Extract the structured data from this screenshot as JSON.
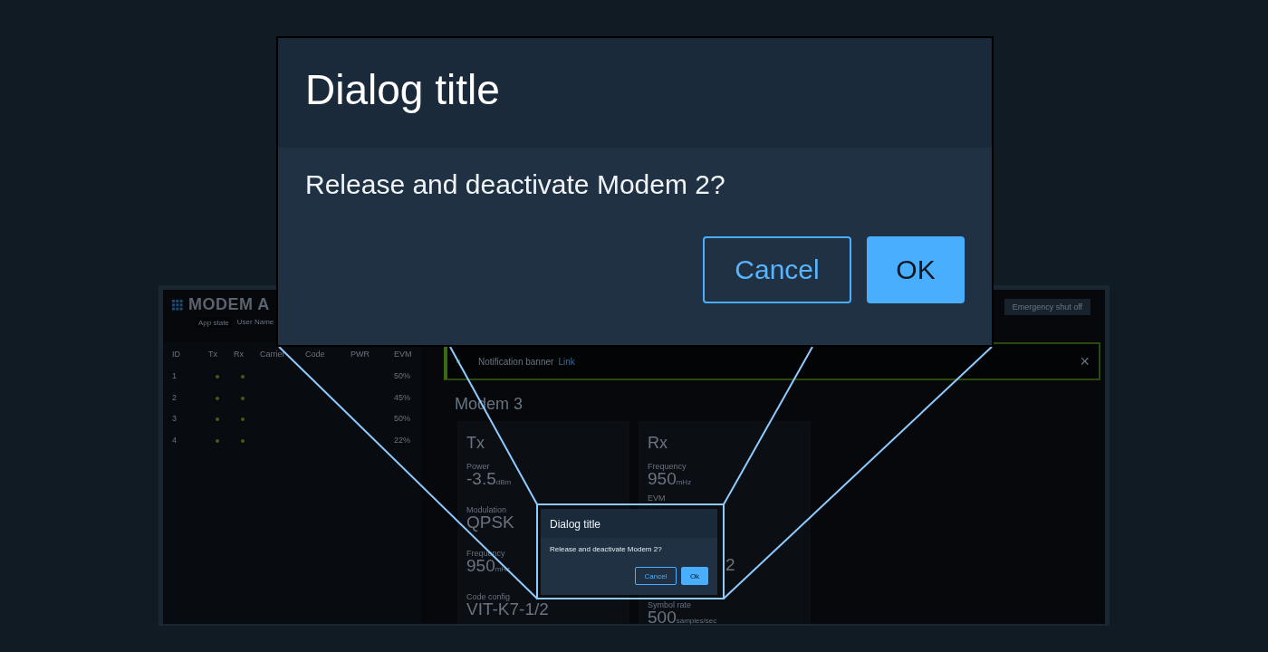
{
  "app": {
    "title": "MODEM A",
    "state": "App state",
    "user": "User Name",
    "emergency_button": "Emergency shut off"
  },
  "table": {
    "columns": [
      "ID",
      "Tx",
      "Rx",
      "Carrier",
      "Code",
      "PWR",
      "EVM"
    ],
    "rows": [
      {
        "id": "1",
        "tx": true,
        "rx": true,
        "evm": "50%"
      },
      {
        "id": "2",
        "tx": true,
        "rx": true,
        "evm": "45%"
      },
      {
        "id": "3",
        "tx": true,
        "rx": true,
        "evm": "50%"
      },
      {
        "id": "4",
        "tx": true,
        "rx": true,
        "evm": "22%"
      }
    ]
  },
  "banner": {
    "text": "Notification banner",
    "link": "Link",
    "close": "×"
  },
  "modem": {
    "title": "Modem 3",
    "cards": [
      {
        "title": "Tx",
        "fields": [
          {
            "label": "Power",
            "value": "-3.5",
            "unit": "dBm"
          },
          {
            "label": "Modulation",
            "value": "QPSK"
          },
          {
            "label": "Frequency",
            "value": "950",
            "unit": "mHz"
          },
          {
            "label": "Code config",
            "value": "VIT-K7-1/2"
          }
        ]
      },
      {
        "title": "Rx",
        "fields": [
          {
            "label": "Frequency",
            "value": "950",
            "unit": "mHz"
          },
          {
            "label": "EVM"
          },
          {
            "value": "2"
          },
          {
            "label": "Symbol rate",
            "value": "500",
            "unit": "samples/sec"
          }
        ]
      }
    ]
  },
  "dialog": {
    "title": "Dialog title",
    "message": "Release and deactivate Modem 2?",
    "cancel": "Cancel",
    "ok": "Ok"
  },
  "zoomed_dialog": {
    "title": "Dialog title",
    "message": "Release and deactivate Modem 2?",
    "cancel": "Cancel",
    "ok": "OK"
  }
}
